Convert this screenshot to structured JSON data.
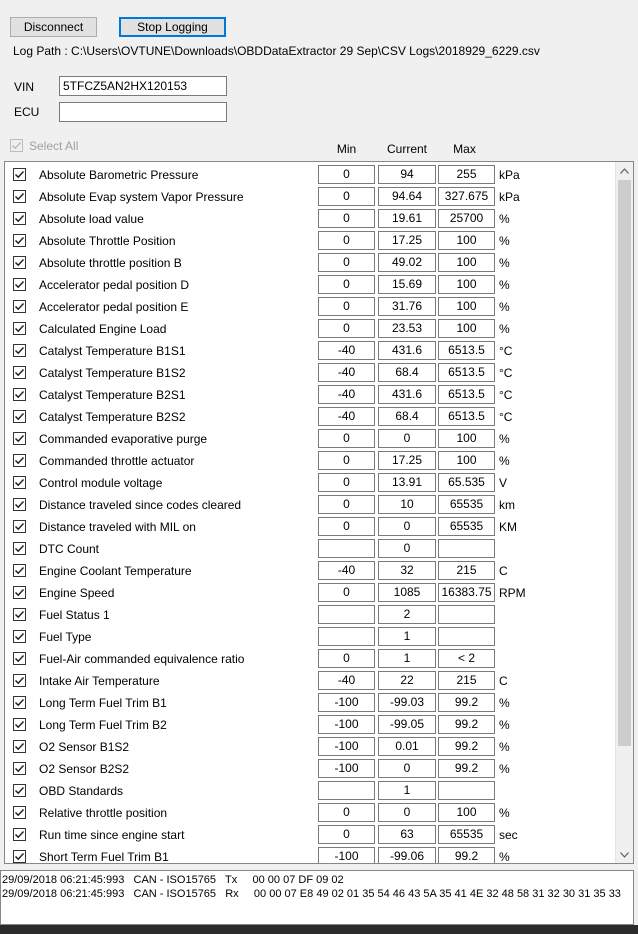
{
  "toolbar": {
    "disconnect_label": "Disconnect",
    "stop_logging_label": "Stop Logging"
  },
  "log_path": "Log Path : C:\\Users\\OVTUNE\\Downloads\\OBDDataExtractor 29 Sep\\CSV Logs\\2018929_6229.csv",
  "vin": {
    "label": "VIN",
    "value": "5TFCZ5AN2HX120153"
  },
  "ecu": {
    "label": "ECU",
    "value": ""
  },
  "select_all_label": "Select All",
  "columns": {
    "min": "Min",
    "current": "Current",
    "max": "Max"
  },
  "icons": {
    "checkbox": "check-icon",
    "scroll_up": "scroll-up-arrow-icon",
    "scroll_down": "scroll-down-arrow-icon"
  },
  "rows": [
    {
      "name": "Absolute Barometric Pressure",
      "min": "0",
      "current": "94",
      "max": "255",
      "unit": "kPa"
    },
    {
      "name": "Absolute Evap system Vapor Pressure",
      "min": "0",
      "current": "94.64",
      "max": "327.675",
      "unit": "kPa"
    },
    {
      "name": "Absolute load value",
      "min": "0",
      "current": "19.61",
      "max": "25700",
      "unit": "%"
    },
    {
      "name": "Absolute Throttle Position",
      "min": "0",
      "current": "17.25",
      "max": "100",
      "unit": "%"
    },
    {
      "name": "Absolute throttle position B",
      "min": "0",
      "current": "49.02",
      "max": "100",
      "unit": "%"
    },
    {
      "name": "Accelerator pedal position D",
      "min": "0",
      "current": "15.69",
      "max": "100",
      "unit": "%"
    },
    {
      "name": "Accelerator pedal position E",
      "min": "0",
      "current": "31.76",
      "max": "100",
      "unit": "%"
    },
    {
      "name": "Calculated Engine Load",
      "min": "0",
      "current": "23.53",
      "max": "100",
      "unit": "%"
    },
    {
      "name": "Catalyst Temperature B1S1",
      "min": "-40",
      "current": "431.6",
      "max": "6513.5",
      "unit": "°C"
    },
    {
      "name": "Catalyst Temperature B1S2",
      "min": "-40",
      "current": "68.4",
      "max": "6513.5",
      "unit": "°C"
    },
    {
      "name": "Catalyst Temperature B2S1",
      "min": "-40",
      "current": "431.6",
      "max": "6513.5",
      "unit": "°C"
    },
    {
      "name": "Catalyst Temperature B2S2",
      "min": "-40",
      "current": "68.4",
      "max": "6513.5",
      "unit": "°C"
    },
    {
      "name": "Commanded evaporative purge",
      "min": "0",
      "current": "0",
      "max": "100",
      "unit": "%"
    },
    {
      "name": "Commanded throttle actuator",
      "min": "0",
      "current": "17.25",
      "max": "100",
      "unit": "%"
    },
    {
      "name": "Control module voltage",
      "min": "0",
      "current": "13.91",
      "max": "65.535",
      "unit": "V"
    },
    {
      "name": "Distance traveled since codes cleared",
      "min": "0",
      "current": "10",
      "max": "65535",
      "unit": "km"
    },
    {
      "name": "Distance traveled with MIL on",
      "min": "0",
      "current": "0",
      "max": "65535",
      "unit": "KM"
    },
    {
      "name": "DTC Count",
      "min": "",
      "current": "0",
      "max": "",
      "unit": ""
    },
    {
      "name": "Engine Coolant Temperature",
      "min": "-40",
      "current": "32",
      "max": "215",
      "unit": "C"
    },
    {
      "name": "Engine Speed",
      "min": "0",
      "current": "1085",
      "max": "16383.75",
      "unit": "RPM"
    },
    {
      "name": "Fuel Status 1",
      "min": "",
      "current": "2",
      "max": "",
      "unit": ""
    },
    {
      "name": "Fuel Type",
      "min": "",
      "current": "1",
      "max": "",
      "unit": ""
    },
    {
      "name": "Fuel-Air commanded equivalence ratio",
      "min": "0",
      "current": "1",
      "max": "< 2",
      "unit": ""
    },
    {
      "name": "Intake Air Temperature",
      "min": "-40",
      "current": "22",
      "max": "215",
      "unit": "C"
    },
    {
      "name": "Long Term Fuel Trim B1",
      "min": "-100",
      "current": "-99.03",
      "max": "99.2",
      "unit": "%"
    },
    {
      "name": "Long Term Fuel Trim B2",
      "min": "-100",
      "current": "-99.05",
      "max": "99.2",
      "unit": "%"
    },
    {
      "name": "O2 Sensor B1S2",
      "min": "-100",
      "current": "0.01",
      "max": "99.2",
      "unit": "%"
    },
    {
      "name": "O2 Sensor B2S2",
      "min": "-100",
      "current": "0",
      "max": "99.2",
      "unit": "%"
    },
    {
      "name": "OBD Standards",
      "min": "",
      "current": "1",
      "max": "",
      "unit": ""
    },
    {
      "name": "Relative throttle position",
      "min": "0",
      "current": "0",
      "max": "100",
      "unit": "%"
    },
    {
      "name": "Run time since engine start",
      "min": "0",
      "current": "63",
      "max": "65535",
      "unit": "sec"
    },
    {
      "name": "Short Term Fuel Trim B1",
      "min": "-100",
      "current": "-99.06",
      "max": "99.2",
      "unit": "%"
    }
  ],
  "log_lines": [
    "29/09/2018 06:21:45:993   CAN - ISO15765   Tx     00 00 07 DF 09 02",
    "29/09/2018 06:21:45:993   CAN - ISO15765   Rx     00 00 07 E8 49 02 01 35 54 46 43 5A 35 41 4E 32 48 58 31 32 30 31 35 33"
  ]
}
